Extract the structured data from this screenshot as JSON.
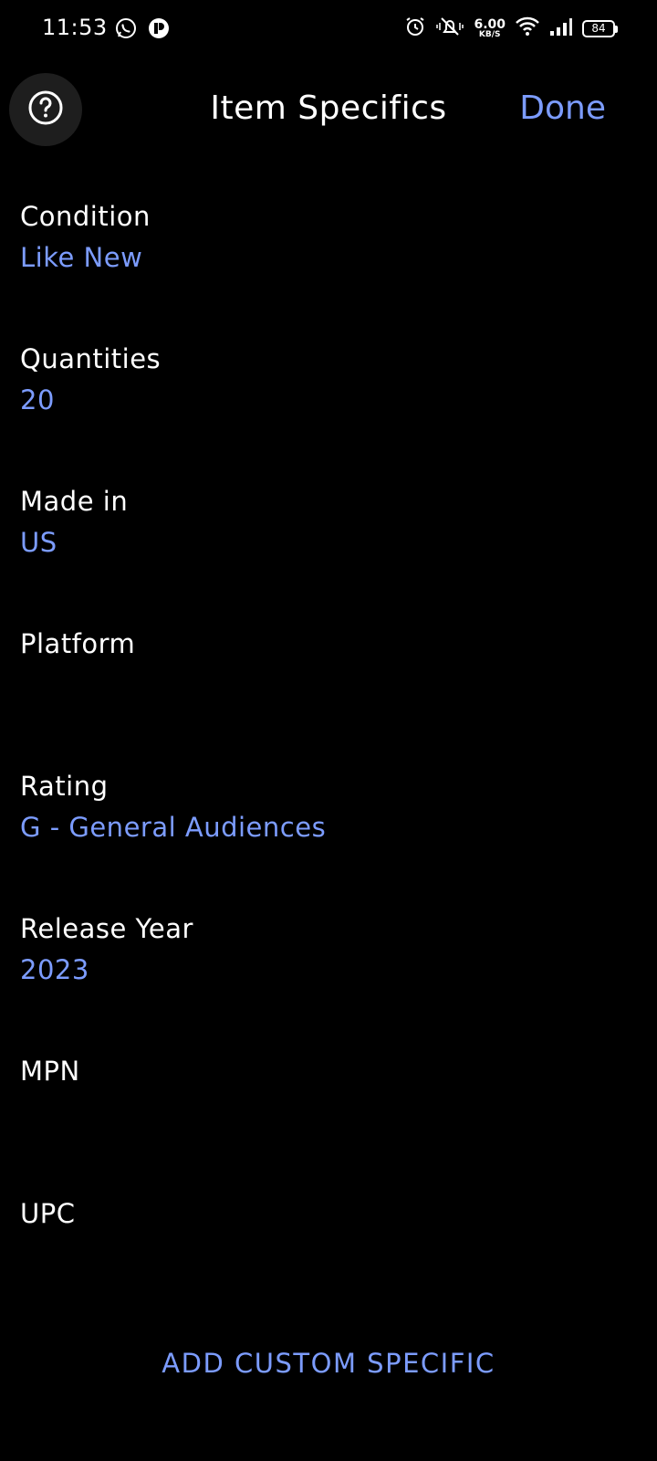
{
  "status_bar": {
    "time": "11:53",
    "speed_value": "6.00",
    "speed_unit": "KB/S",
    "battery": "84",
    "left_icons": [
      "whatsapp-icon",
      "app-icon"
    ],
    "right_icons": [
      "alarm-icon",
      "mute-icon",
      "wifi-icon",
      "signal-icon",
      "battery-icon"
    ]
  },
  "header": {
    "title": "Item Specifics",
    "done_label": "Done",
    "help_icon": "help-icon"
  },
  "fields": [
    {
      "label": "Condition",
      "value": "Like New"
    },
    {
      "label": "Quantities",
      "value": "20"
    },
    {
      "label": "Made in",
      "value": "US"
    },
    {
      "label": "Platform",
      "value": ""
    },
    {
      "label": "Rating",
      "value": "G - General Audiences"
    },
    {
      "label": "Release Year",
      "value": "2023"
    },
    {
      "label": "MPN",
      "value": ""
    },
    {
      "label": "UPC",
      "value": ""
    }
  ],
  "add_custom_label": "ADD CUSTOM SPECIFIC",
  "colors": {
    "background": "#000000",
    "accent": "#7c9cff",
    "text": "#ffffff"
  }
}
